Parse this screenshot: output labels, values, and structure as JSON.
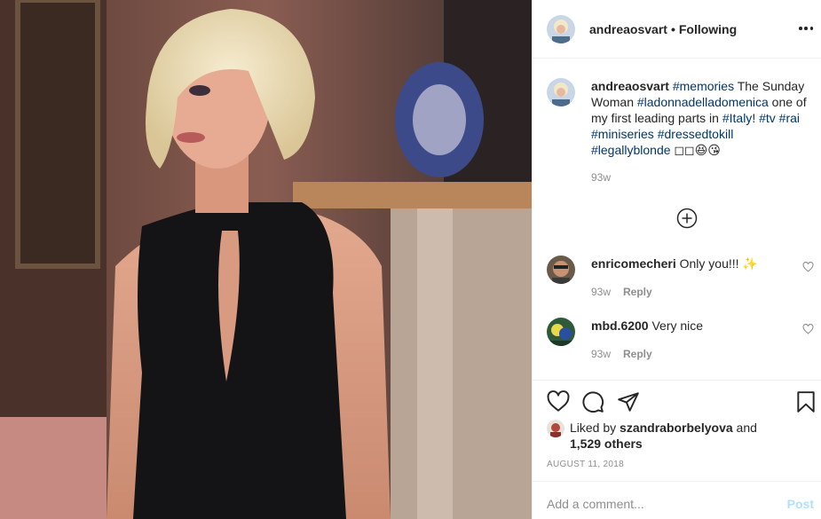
{
  "post": {
    "author": "andreaosvart",
    "follow_status": "Following",
    "separator": "•"
  },
  "caption": {
    "author": "andreaosvart",
    "parts": {
      "memories": "#memories",
      "text1": " The Sunday Woman ",
      "ladonna": "#ladonnadelladomenica",
      "text2": " one of my first leading parts in ",
      "italy": "#Italy",
      "text3": "! ",
      "tv": "#tv",
      "rai": "#rai",
      "miniseries": "#miniseries",
      "dressed": "#dressedtokill",
      "legally": "#legallyblonde",
      "emoji": " ◻◻😆😘"
    },
    "time": "93w"
  },
  "comments": [
    {
      "user": "enricomecheri",
      "text": "Only you!!! ✨",
      "time": "93w",
      "reply": "Reply"
    },
    {
      "user": "mbd.6200",
      "text": "Very nice",
      "time": "93w",
      "reply": "Reply"
    }
  ],
  "likes": {
    "prefix": "Liked by ",
    "user": "szandraborbelyova",
    "middle": " and",
    "others": "1,529 others"
  },
  "date": "AUGUST 11, 2018",
  "add_comment": {
    "placeholder": "Add a comment...",
    "post_label": "Post"
  },
  "icons": [
    "more-icon",
    "load-more-icon",
    "heart-icon",
    "comment-icon",
    "share-icon",
    "bookmark-icon"
  ],
  "colors": {
    "hashtag": "#00376b",
    "muted": "#8e8e8e",
    "post_disabled": "#b2dffc"
  }
}
